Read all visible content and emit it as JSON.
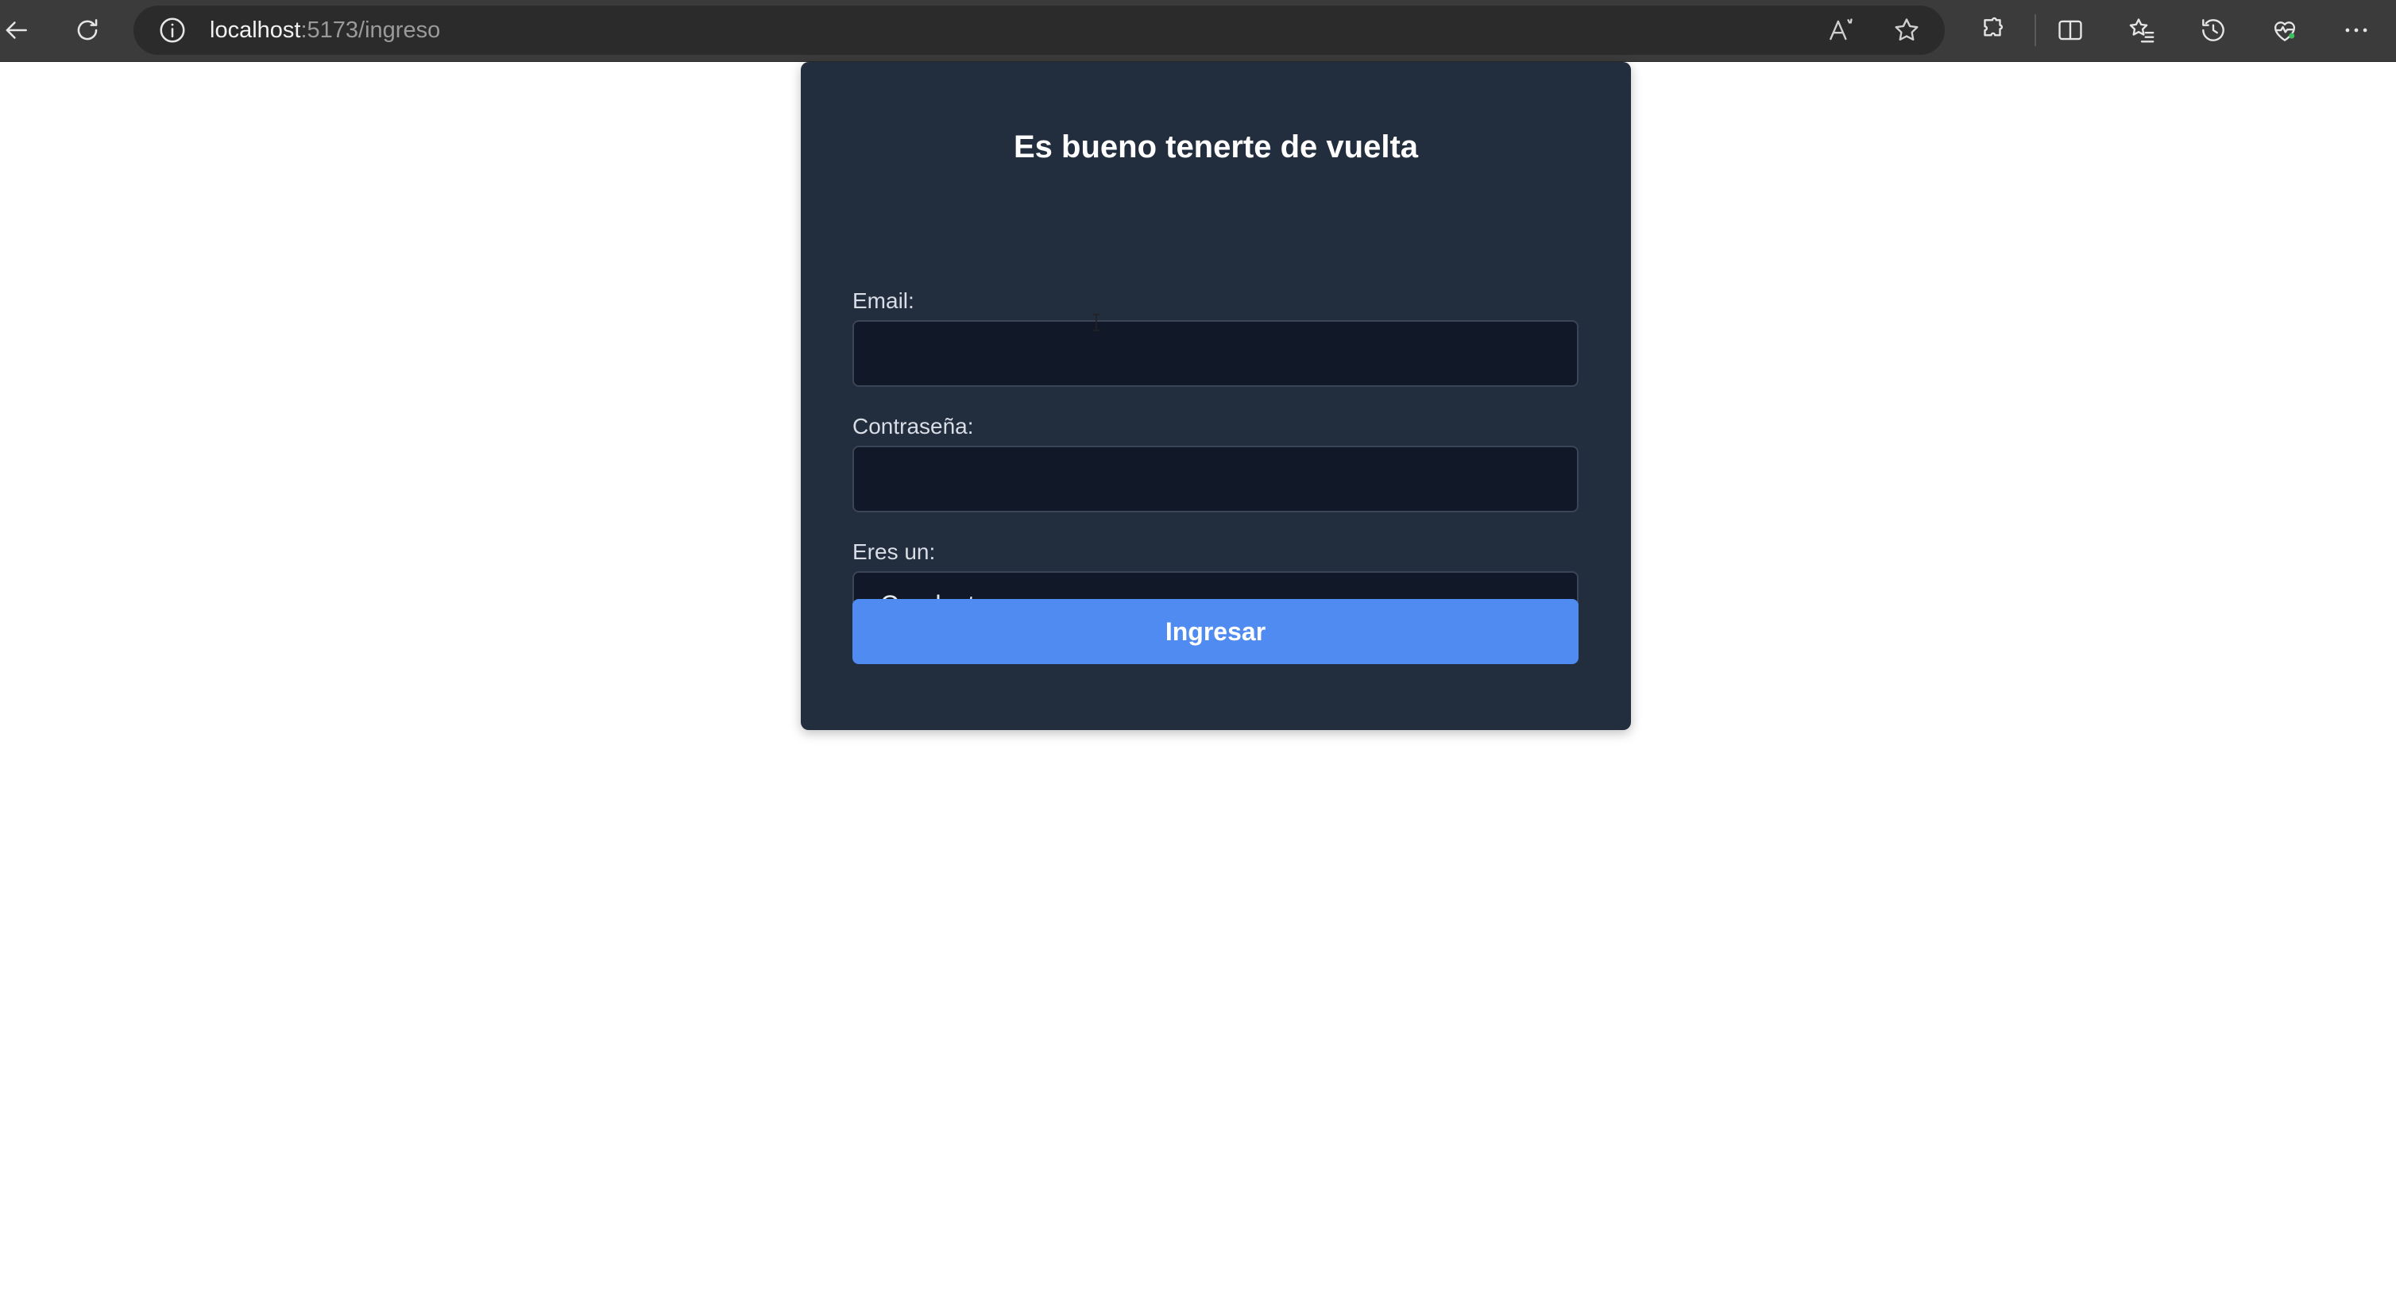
{
  "browser": {
    "url_host": "localhost",
    "url_path": ":5173/ingreso"
  },
  "login": {
    "title": "Es bueno tenerte de vuelta",
    "email_label": "Email:",
    "email_value": "",
    "password_label": "Contraseña:",
    "password_value": "",
    "role_label": "Eres un:",
    "role_selected": "Conductor",
    "submit_label": "Ingresar"
  },
  "colors": {
    "card_bg": "#222d3d",
    "input_bg": "#111827",
    "button_bg": "#4f8bf0",
    "toolbar_bg": "#3b3b3b"
  }
}
